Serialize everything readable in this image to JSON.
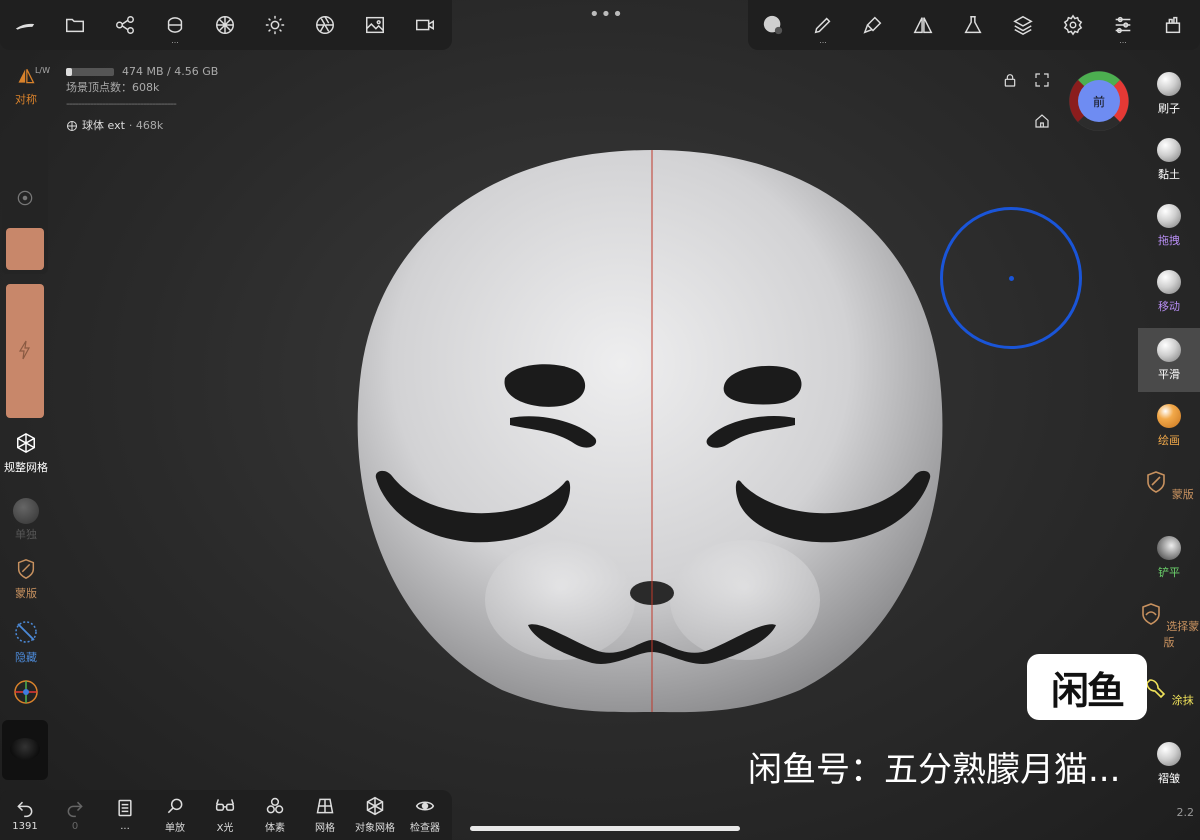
{
  "stats": {
    "memory": "474 MB / 4.56 GB",
    "vertex_count": "场景顶点数：608k",
    "object_name": "球体 ext",
    "object_count": "· 468k"
  },
  "left_panel": {
    "symmetry": {
      "label": "对称",
      "badge": "L/W"
    },
    "remesh": {
      "label": "规整网格"
    },
    "solo": {
      "label": "单独"
    },
    "mask": {
      "label": "蒙版"
    },
    "hide": {
      "label": "隐藏"
    }
  },
  "right_panel": [
    {
      "label": "刷子",
      "icon": "sphere",
      "color": "#ffffff"
    },
    {
      "label": "黏土",
      "icon": "sphere",
      "color": "#ffffff"
    },
    {
      "label": "拖拽",
      "icon": "sphere-pinch",
      "color": "#b58cf0"
    },
    {
      "label": "移动",
      "icon": "sphere-move",
      "color": "#b58cf0"
    },
    {
      "label": "平滑",
      "icon": "sphere-smooth",
      "color": "#ffffff"
    },
    {
      "label": "绘画",
      "icon": "sphere-paint",
      "color": "#f2a94a"
    },
    {
      "label": "蒙版",
      "icon": "shield-icon",
      "color": "#c7915f"
    },
    {
      "label": "铲平",
      "icon": "sphere-flatten",
      "color": "#6bd16b"
    },
    {
      "label": "选择蒙版",
      "icon": "shield-icon",
      "color": "#c7915f"
    },
    {
      "label": "涂抹",
      "icon": "smudge-icon",
      "color": "#f0e25a"
    },
    {
      "label": "褶皱",
      "icon": "sphere-crease",
      "color": "#ffffff"
    }
  ],
  "bottom_bar": [
    {
      "label": "1391",
      "icon": "undo-icon"
    },
    {
      "label": "0",
      "icon": "redo-icon"
    },
    {
      "label": "...",
      "icon": "history-icon"
    },
    {
      "label": "单放",
      "icon": "zoom-icon"
    },
    {
      "label": "X光",
      "icon": "xray-icon"
    },
    {
      "label": "体素",
      "icon": "voxel-icon"
    },
    {
      "label": "网格",
      "icon": "grid-icon"
    },
    {
      "label": "对象网格",
      "icon": "wireframe-icon"
    },
    {
      "label": "检查器",
      "icon": "inspector-icon"
    }
  ],
  "gizmo": {
    "label": "前"
  },
  "watermark": {
    "logo": "闲鱼",
    "text": "闲鱼号：五分熟朦月猫..."
  },
  "version": "2.2",
  "colors": {
    "accent_blue": "#1a55d8",
    "swatch": "#c8876a",
    "mask_orange": "#c7915f"
  }
}
